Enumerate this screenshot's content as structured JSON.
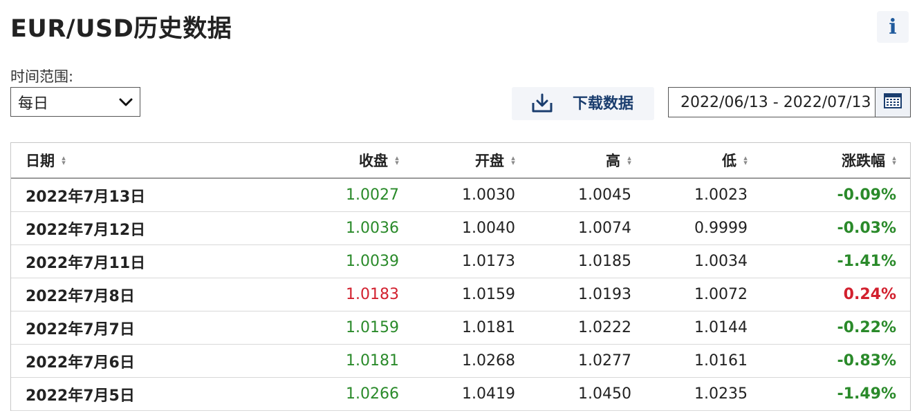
{
  "page": {
    "title": "EUR/USD历史数据",
    "info_label": "i"
  },
  "controls": {
    "range_label": "时间范围:",
    "range_value": "每日",
    "download_label": "下载数据",
    "date_range": "2022/06/13 - 2022/07/13"
  },
  "colors": {
    "up": "#d2202e",
    "down": "#2a8a2a",
    "accent": "#1a3d6e"
  },
  "table": {
    "headers": [
      "日期",
      "收盘",
      "开盘",
      "高",
      "低",
      "涨跌幅"
    ],
    "rows": [
      {
        "date": "2022年7月13日",
        "close": "1.0027",
        "open": "1.0030",
        "high": "1.0045",
        "low": "1.0023",
        "change": "-0.09%",
        "dir": "down"
      },
      {
        "date": "2022年7月12日",
        "close": "1.0036",
        "open": "1.0040",
        "high": "1.0074",
        "low": "0.9999",
        "change": "-0.03%",
        "dir": "down"
      },
      {
        "date": "2022年7月11日",
        "close": "1.0039",
        "open": "1.0173",
        "high": "1.0185",
        "low": "1.0034",
        "change": "-1.41%",
        "dir": "down"
      },
      {
        "date": "2022年7月8日",
        "close": "1.0183",
        "open": "1.0159",
        "high": "1.0193",
        "low": "1.0072",
        "change": "0.24%",
        "dir": "up"
      },
      {
        "date": "2022年7月7日",
        "close": "1.0159",
        "open": "1.0181",
        "high": "1.0222",
        "low": "1.0144",
        "change": "-0.22%",
        "dir": "down"
      },
      {
        "date": "2022年7月6日",
        "close": "1.0181",
        "open": "1.0268",
        "high": "1.0277",
        "low": "1.0161",
        "change": "-0.83%",
        "dir": "down"
      },
      {
        "date": "2022年7月5日",
        "close": "1.0266",
        "open": "1.0419",
        "high": "1.0450",
        "low": "1.0235",
        "change": "-1.49%",
        "dir": "down"
      }
    ]
  }
}
